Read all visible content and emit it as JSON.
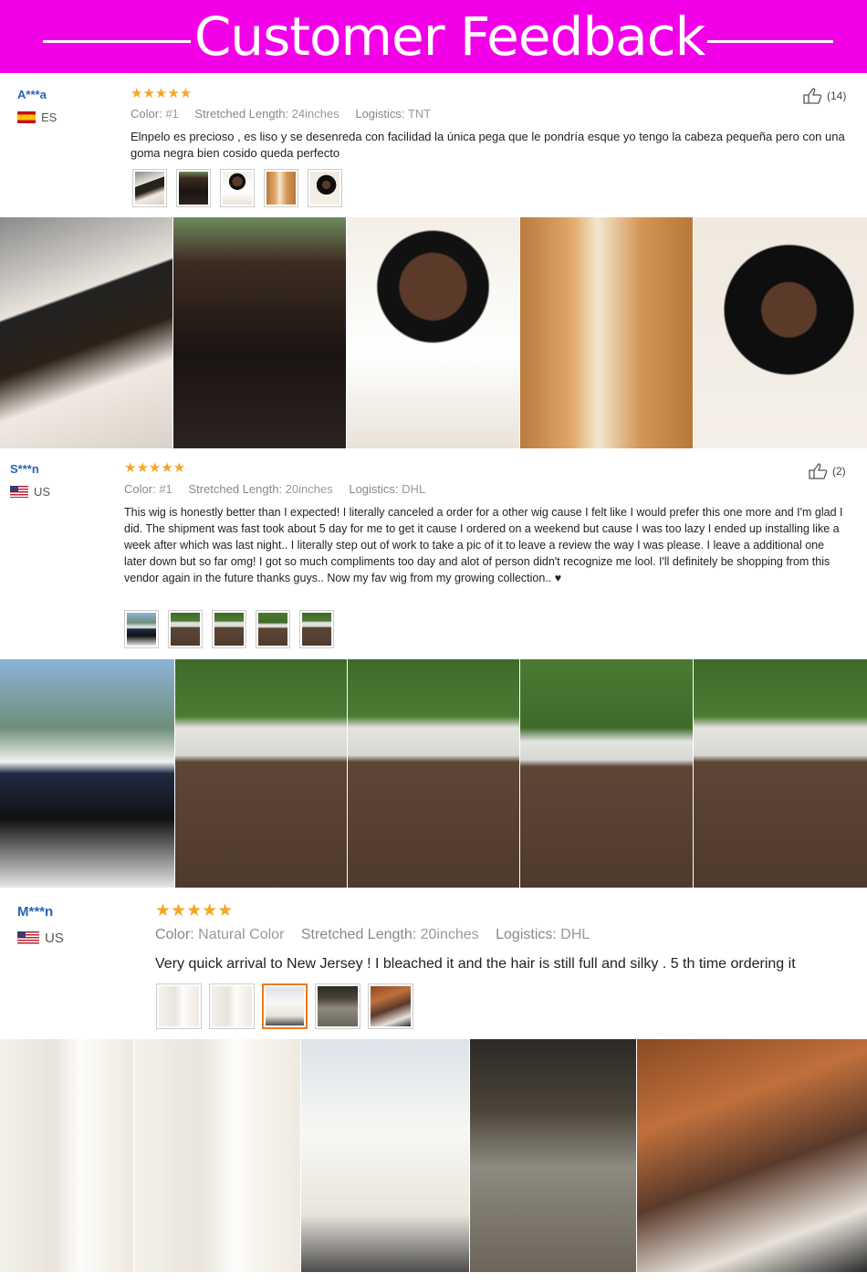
{
  "header": {
    "title": "Customer Feedback"
  },
  "reviews": [
    {
      "user": "A***a",
      "country": "ES",
      "stars": "★★★★★",
      "color_key": "Color:",
      "color_val": "#1",
      "length_key": "Stretched Length:",
      "length_val": "24inches",
      "logistics_key": "Logistics:",
      "logistics_val": "TNT",
      "likes": "(14)",
      "text": "Elnpelo es precioso , es liso y se desenreda con facilidad la única pega que le pondría esque yo tengo la cabeza pequeña pero con una goma negra bien cosido queda perfecto"
    },
    {
      "user": "S***n",
      "country": "US",
      "stars": "★★★★★",
      "color_key": "Color:",
      "color_val": "#1",
      "length_key": "Stretched Length:",
      "length_val": "20inches",
      "logistics_key": "Logistics:",
      "logistics_val": "DHL",
      "likes": "(2)",
      "text": "This wig is honestly better than I expected! I literally canceled a order for a other wig cause I felt like I would prefer this one more and I'm glad I did. The shipment was fast took about 5 day for me to get it cause I ordered on a weekend but cause I was too lazy I ended up installing like a week after which was last night.. I literally step out of work to take a pic of it to leave a review the way I was please. I leave a additional one later down but so far omg! I got so much compliments too day and alot of person didn't recognize me lool. I'll definitely be shopping from this vendor again in the future thanks guys.. Now my fav wig from my growing collection.. ♥"
    },
    {
      "user": "M***n",
      "country": "US",
      "stars": "★★★★★",
      "color_key": "Color:",
      "color_val": "Natural Color",
      "length_key": "Stretched Length:",
      "length_val": "20inches",
      "logistics_key": "Logistics:",
      "logistics_val": "DHL",
      "text": "Very quick arrival to New Jersey ! I bleached it and the hair is still full and silky . 5 th time ordering it"
    }
  ],
  "colors": {
    "header_bg": "#f200e8",
    "star": "#f5a623",
    "username": "#2a62b8",
    "selected_thumb": "#f07a1a"
  },
  "icons": {
    "likes": "thumbs-up-icon",
    "flag_es": "spain-flag-icon",
    "flag_us": "usa-flag-icon"
  }
}
